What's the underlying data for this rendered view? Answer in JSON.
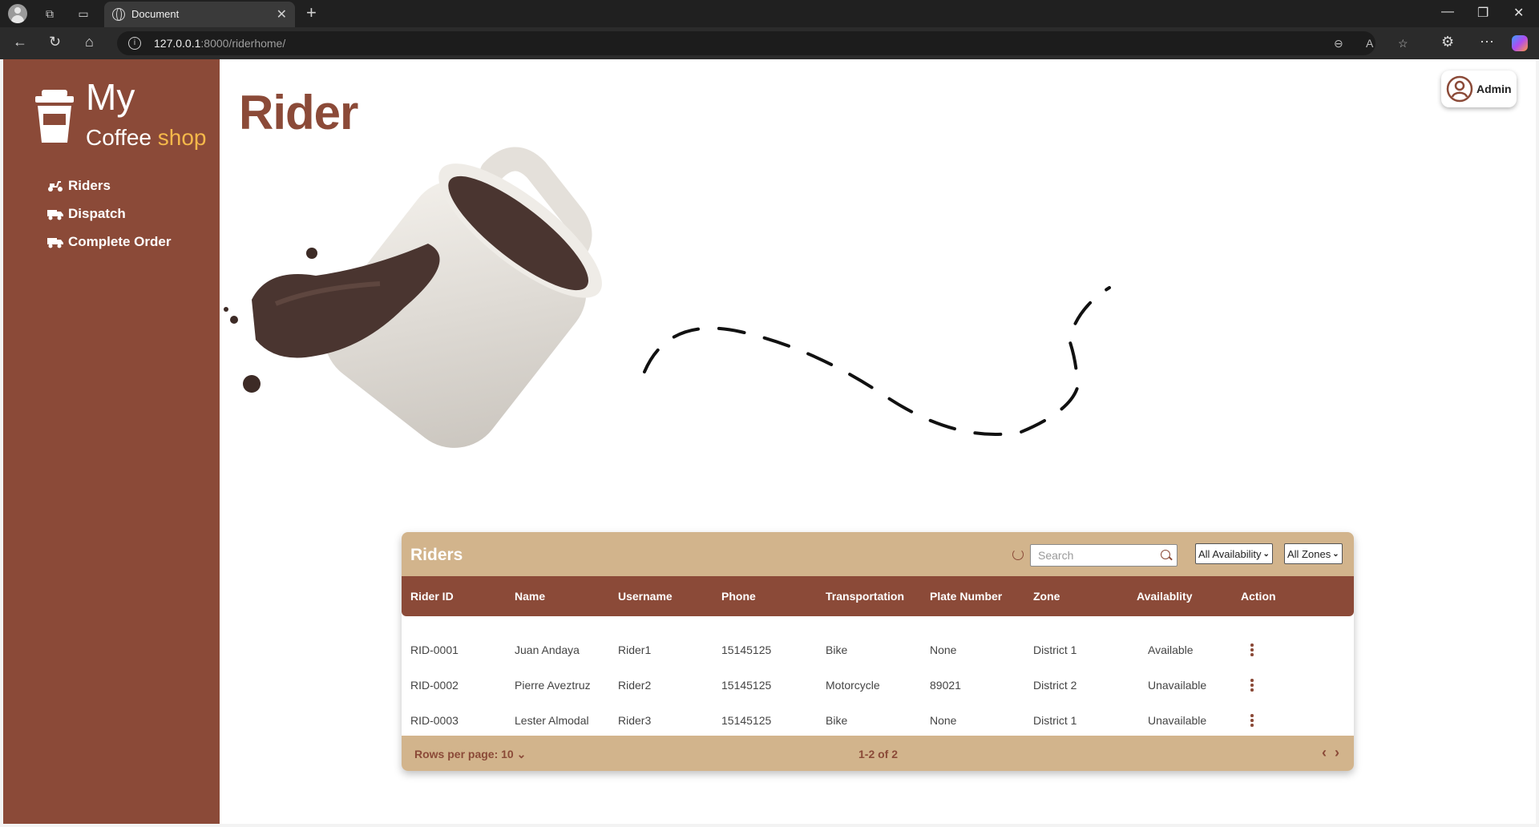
{
  "browser": {
    "tab_title": "Document",
    "url_host": "127.0.0.1",
    "url_rest": ":8000/riderhome/"
  },
  "sidebar": {
    "logo_my": "My",
    "logo_coffee": "Coffee",
    "logo_shop": "shop",
    "items": [
      {
        "label": "Riders",
        "icon": "scooter-icon"
      },
      {
        "label": "Dispatch",
        "icon": "truck-icon"
      },
      {
        "label": "Complete Order",
        "icon": "truck-icon"
      }
    ]
  },
  "header": {
    "title": "Rider",
    "user_label": "Admin"
  },
  "table": {
    "title": "Riders",
    "search_placeholder": "Search",
    "filter_availability": "All Availability",
    "filter_zone": "All Zones",
    "columns": [
      "Rider ID",
      "Name",
      "Username",
      "Phone",
      "Transportation",
      "Plate Number",
      "Zone",
      "Availablity",
      "Action"
    ],
    "rows": [
      [
        "RID-0001",
        "Juan Andaya",
        "Rider1",
        "15145125",
        "Bike",
        "None",
        "District 1",
        "Available"
      ],
      [
        "RID-0002",
        "Pierre Aveztruz",
        "Rider2",
        "15145125",
        "Motorcycle",
        "89021",
        "District 2",
        "Unavailable"
      ],
      [
        "RID-0003",
        "Lester Almodal",
        "Rider3",
        "15145125",
        "Bike",
        "None",
        "District 1",
        "Unavailable"
      ]
    ],
    "rows_per_page_label": "Rows per page:",
    "rows_per_page": "10",
    "pagination": "1-2 of 2"
  },
  "colors": {
    "sidebar": "#8b4a38",
    "accent_tan": "#d2b48c",
    "shop_text": "#f5b84a"
  }
}
